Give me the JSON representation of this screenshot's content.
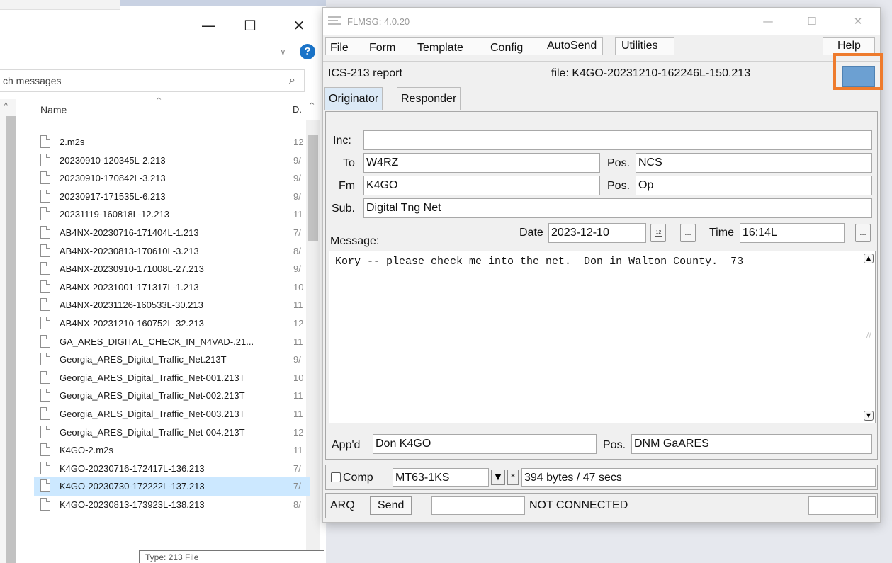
{
  "explorer": {
    "search_placeholder": "ch messages",
    "column_name": "Name",
    "column_date": "D.",
    "files": [
      {
        "name": "2.m2s",
        "date": "12"
      },
      {
        "name": "20230910-120345L-2.213",
        "date": "9/"
      },
      {
        "name": "20230910-170842L-3.213",
        "date": "9/"
      },
      {
        "name": "20230917-171535L-6.213",
        "date": "9/"
      },
      {
        "name": "20231119-160818L-12.213",
        "date": "11"
      },
      {
        "name": "AB4NX-20230716-171404L-1.213",
        "date": "7/"
      },
      {
        "name": "AB4NX-20230813-170610L-3.213",
        "date": "8/"
      },
      {
        "name": "AB4NX-20230910-171008L-27.213",
        "date": "9/"
      },
      {
        "name": "AB4NX-20231001-171317L-1.213",
        "date": "10"
      },
      {
        "name": "AB4NX-20231126-160533L-30.213",
        "date": "11"
      },
      {
        "name": "AB4NX-20231210-160752L-32.213",
        "date": "12"
      },
      {
        "name": "GA_ARES_DIGITAL_CHECK_IN_N4VAD-.21...",
        "date": "11"
      },
      {
        "name": "Georgia_ARES_Digital_Traffic_Net.213T",
        "date": "9/"
      },
      {
        "name": "Georgia_ARES_Digital_Traffic_Net-001.213T",
        "date": "10"
      },
      {
        "name": "Georgia_ARES_Digital_Traffic_Net-002.213T",
        "date": "11"
      },
      {
        "name": "Georgia_ARES_Digital_Traffic_Net-003.213T",
        "date": "11"
      },
      {
        "name": "Georgia_ARES_Digital_Traffic_Net-004.213T",
        "date": "12"
      },
      {
        "name": "K4GO-2.m2s",
        "date": "11"
      },
      {
        "name": "K4GO-20230716-172417L-136.213",
        "date": "7/"
      },
      {
        "name": "K4GO-20230730-172222L-137.213",
        "date": "7/"
      },
      {
        "name": "K4GO-20230813-173923L-138.213",
        "date": "8/"
      }
    ],
    "tooltip": "Type: 213 File"
  },
  "flmsg": {
    "title": "FLMSG: 4.0.20",
    "menu": {
      "file": "File",
      "form": "Form",
      "template": "Template",
      "config": "Config",
      "autosend": "AutoSend",
      "utilities": "Utilities",
      "help": "Help"
    },
    "form_name": "ICS-213 report",
    "file_label": "file: K4GO-20231210-162246L-150.213",
    "tabs": {
      "originator": "Originator",
      "responder": "Responder"
    },
    "fields": {
      "inc_label": "Inc:",
      "inc_value": "",
      "to_label": "To",
      "to_value": "W4RZ",
      "to_pos_label": "Pos.",
      "to_pos_value": "NCS",
      "fm_label": "Fm",
      "fm_value": "K4GO",
      "fm_pos_label": "Pos.",
      "fm_pos_value": "Op",
      "sub_label": "Sub.",
      "sub_value": "Digital Tng Net",
      "message_label": "Message:",
      "date_label": "Date",
      "date_value": "2023-12-10",
      "time_label": "Time",
      "time_value": "16:14L",
      "message_text": "Kory -- please check me into the net.  Don in Walton County.  73",
      "appd_label": "App'd",
      "appd_value": "Don  K4GO",
      "appd_pos_label": "Pos.",
      "appd_pos_value": "DNM GaARES"
    },
    "transfer": {
      "comp_label": "Comp",
      "mode": "MT63-1KS",
      "star": "*",
      "size_info": "394 bytes / 47 secs",
      "arq_label": "ARQ",
      "send_label": "Send",
      "status": "NOT CONNECTED"
    },
    "colors": {
      "highlight": "#ee7b2d",
      "blue_button": "#6ca0d2"
    }
  }
}
